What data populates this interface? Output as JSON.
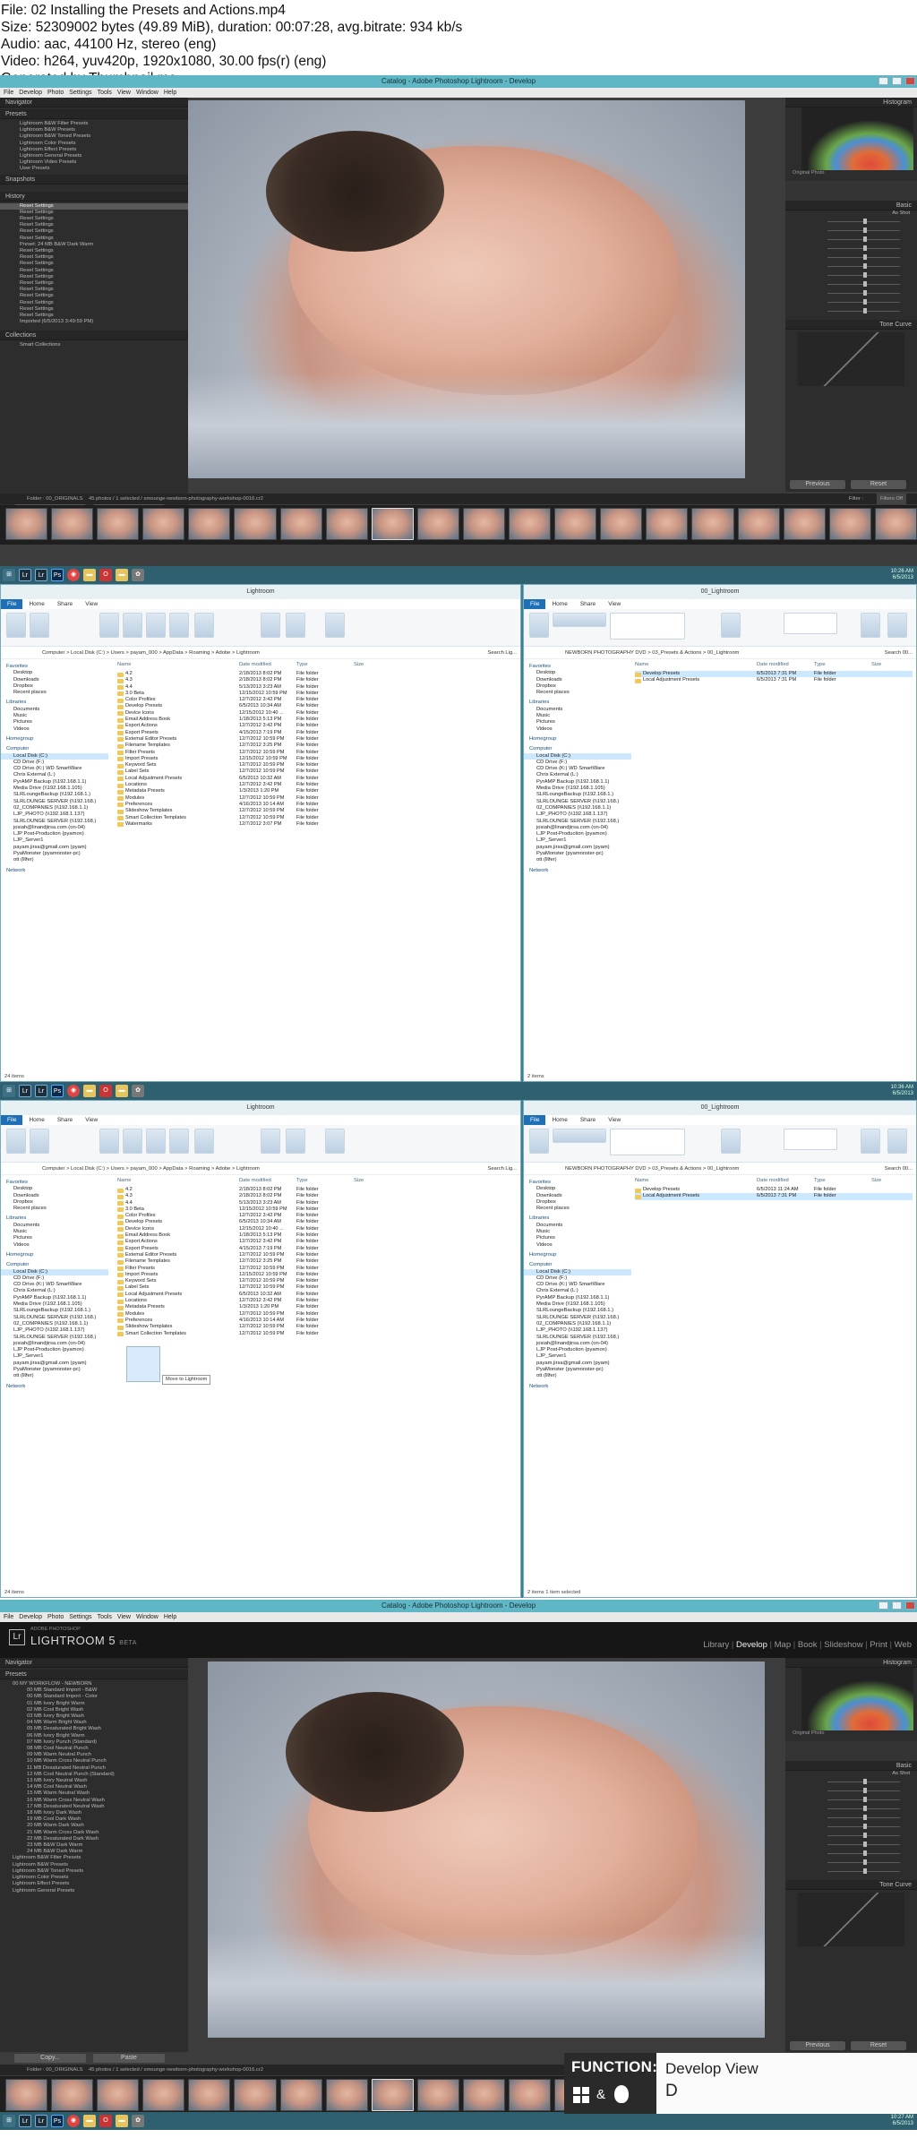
{
  "info": {
    "line1": "File: 02 Installing the Presets and Actions.mp4",
    "line2": "Size: 52309002 bytes (49.89 MiB), duration: 00:07:28, avg.bitrate: 934 kb/s",
    "line3": "Audio: aac, 44100 Hz, stereo (eng)",
    "line4": "Video: h264, yuv420p, 1920x1080, 30.00 fps(r) (eng)",
    "line5": "Generated by Thumbnail me"
  },
  "lr": {
    "title": "Catalog - Adobe Photoshop Lightroom - Develop",
    "menu": [
      "File",
      "Develop",
      "Photo",
      "Settings",
      "Tools",
      "View",
      "Window",
      "Help"
    ],
    "navigator": "Navigator",
    "presets": "Presets",
    "presets_items": [
      "Lightroom B&W Filter Presets",
      "Lightroom B&W Presets",
      "Lightroom B&W Toned Presets",
      "Lightroom Color Presets",
      "Lightroom Effect Presets",
      "Lightroom General Presets",
      "Lightroom Video Presets",
      "User Presets"
    ],
    "snapshots": "Snapshots",
    "history": "History",
    "history_items": [
      "Reset Settings",
      "Reset Settings",
      "Reset Settings",
      "Reset Settings",
      "Reset Settings",
      "Reset Settings",
      "Preset: 24 MB B&W Dark Warm",
      "Reset Settings",
      "Reset Settings",
      "Reset Settings",
      "Reset Settings",
      "Reset Settings",
      "Reset Settings",
      "Reset Settings",
      "Reset Settings",
      "Reset Settings",
      "Reset Settings",
      "Reset Settings",
      "Imported (6/5/2013 3:49:59 PM)"
    ],
    "collections": "Collections",
    "collections_item": "Smart Collections",
    "copy": "Copy...",
    "paste": "Paste",
    "histogram": "Histogram",
    "basic": "Basic",
    "tone_curve": "Tone Curve",
    "previous": "Previous",
    "reset": "Reset",
    "as_shot": "As Shot",
    "original_photo": "Original Photo",
    "folder": "Folder : 00_ORIGINALS",
    "photos": "45 photos / 1 selected /",
    "filename": "smounge-newborn-photography-workshop-0016.cr2",
    "filter": "Filter :",
    "filters_off": "Filters Off",
    "brand_small": "ADOBE PHOTOSHOP",
    "brand": "LIGHTROOM 5",
    "brand_beta": "BETA",
    "modules": [
      "Library",
      "Develop",
      "Map",
      "Book",
      "Slideshow",
      "Print",
      "Web"
    ],
    "presets2_group": "00 MY WORKFLOW - NEWBORN",
    "presets2_items": [
      "00 MB Standard Import - B&W",
      "00 MB Standard Import - Color",
      "01 MB Ivory Bright Warm",
      "02 MB Cool Bright Wash",
      "03 MB Ivory Bright Wash",
      "04 MB Warm Bright Wash",
      "05 MB Desaturated Bright Wash",
      "06 MB Ivory Bright Warm",
      "07 MB Ivory Punch (Standard)",
      "08 MB Cool Neutral Punch",
      "09 MB Warm Neutral Punch",
      "10 MB Warm Cross Neutral Punch",
      "11 MB Desaturated Neutral Punch",
      "12 MB Cool Neutral Punch (Standard)",
      "13 MB Ivory Neutral Wash",
      "14 MB Cool Neutral Wash",
      "15 MB Warm Neutral Wash",
      "16 MB Warm Cross Neutral Wash",
      "17 MB Desaturated Neutral Wash",
      "18 MB Ivory Dark Wash",
      "19 MB Cool Dark Wash",
      "20 MB Warm Dark Wash",
      "21 MB Warm Cross Dark Wash",
      "22 MB Desaturated Dark Wash",
      "23 MB B&W Dark Warm",
      "24 MB B&W Dark Warm"
    ],
    "presets2_more": [
      "Lightroom B&W Filter Presets",
      "Lightroom B&W Presets",
      "Lightroom B&W Toned Presets",
      "Lightroom Color Presets",
      "Lightroom Effect Presets",
      "Lightroom General Presets"
    ]
  },
  "explorer": {
    "left_title": "Lightroom",
    "right_title": "00_Lightroom",
    "tabs": [
      "File",
      "Home",
      "Share",
      "View"
    ],
    "path_left": "Computer > Local Disk (C:) > Users > payam_000 > AppData > Roaming > Adobe > Lightroom",
    "path_right": "NEWBORN PHOTOGRAPHY DVD > 03_Presets & Actions > 00_Lightroom",
    "search_left": "Search Lig...",
    "search_right": "Search 00...",
    "col_name": "Name",
    "col_date": "Date modified",
    "col_type": "Type",
    "col_size": "Size",
    "ribbon_left": [
      "Copy",
      "Paste",
      "Move to",
      "Copy to",
      "Delete",
      "Rename",
      "New folder",
      "Properties",
      "Open",
      "Select all"
    ],
    "ribbon_right": [
      "Navigation pane",
      "Preview pane",
      "Details pane",
      "Extra large icons",
      "Large icons",
      "Medium icons",
      "Small icons",
      "List",
      "Details",
      "Sort by",
      "Item check boxes",
      "File name extensions",
      "Hidden items",
      "Hide selected items",
      "Options"
    ],
    "nav": {
      "favorites": "Favorites",
      "fav_items": [
        "Desktop",
        "Downloads",
        "Dropbox",
        "Recent places"
      ],
      "libraries": "Libraries",
      "lib_items": [
        "Documents",
        "Music",
        "Pictures",
        "Videos"
      ],
      "homegroup": "Homegroup",
      "computer": "Computer",
      "comp_items": [
        "Local Disk (C:)",
        "CD Drive (F:)",
        "CD Drive (K:) WD SmartWare",
        "Chris External (L:)",
        "PyrAMP Backup (\\\\192.168.1.1)",
        "Media Drive (\\\\192.168.1.105)",
        "SLRLoungeBackup (\\\\192.168.1.)",
        "SLRLOUNGE SERVER (\\\\192.168.)",
        "02_COMPANIES (\\\\192.168.1.1)",
        "LJP_PHOTO (\\\\192.168.1.137)",
        "SLRLOUNGE SERVER (\\\\192.168.)",
        "josiah@linandjirsa.com (on-04)",
        "LJP Post-Production (pyamon)",
        "LJP_Server1",
        "payam.jirsa@gmail.com (pyam)",
        "PyaMonster (pyamonster-pc)",
        "ott (lllfer)"
      ],
      "network": "Network"
    },
    "left_rows": [
      [
        "4.2",
        "2/18/2013 8:02 PM",
        "File folder"
      ],
      [
        "4.3",
        "2/18/2013 8:02 PM",
        "File folder"
      ],
      [
        "4.4",
        "5/13/2013 3:23 AM",
        "File folder"
      ],
      [
        "3.0 Beta",
        "12/15/2012 10:59 PM",
        "File folder"
      ],
      [
        "Color Profiles",
        "12/7/2012 3:42 PM",
        "File folder"
      ],
      [
        "Develop Presets",
        "6/5/2013 10:34 AM",
        "File folder"
      ],
      [
        "Device Icons",
        "12/15/2012 10:40 ...",
        "File folder"
      ],
      [
        "Email Address Book",
        "1/18/2013 5:13 PM",
        "File folder"
      ],
      [
        "Export Actions",
        "12/7/2012 3:42 PM",
        "File folder"
      ],
      [
        "Export Presets",
        "4/15/2013 7:19 PM",
        "File folder"
      ],
      [
        "External Editor Presets",
        "12/7/2012 10:59 PM",
        "File folder"
      ],
      [
        "Filename Templates",
        "12/7/2012 3:25 PM",
        "File folder"
      ],
      [
        "Filter Presets",
        "12/7/2012 10:59 PM",
        "File folder"
      ],
      [
        "Import Presets",
        "12/15/2012 10:59 PM",
        "File folder"
      ],
      [
        "Keyword Sets",
        "12/7/2012 10:59 PM",
        "File folder"
      ],
      [
        "Label Sets",
        "12/7/2012 10:59 PM",
        "File folder"
      ],
      [
        "Local Adjustment Presets",
        "6/5/2013 10:32 AM",
        "File folder"
      ],
      [
        "Locations",
        "12/7/2012 3:42 PM",
        "File folder"
      ],
      [
        "Metadata Presets",
        "1/3/2013 1:20 PM",
        "File folder"
      ],
      [
        "Modules",
        "12/7/2012 10:59 PM",
        "File folder"
      ],
      [
        "Preferences",
        "4/16/2013 10:14 AM",
        "File folder"
      ],
      [
        "Slideshow Templates",
        "12/7/2012 10:59 PM",
        "File folder"
      ],
      [
        "Smart Collection Templates",
        "12/7/2012 10:59 PM",
        "File folder"
      ],
      [
        "Watermarks",
        "12/7/2012 3:07 PM",
        "File folder"
      ]
    ],
    "right_rows": [
      [
        "Develop Presets",
        "6/5/2013 7:31 PM",
        "File folder"
      ],
      [
        "Local Adjustment Presets",
        "6/5/2013 7:31 PM",
        "File folder"
      ]
    ],
    "right_rows_b": [
      [
        "Develop Presets",
        "6/5/2013 11:24 AM",
        "File folder"
      ],
      [
        "Local Adjustment Presets",
        "6/5/2013 7:31 PM",
        "File folder"
      ]
    ],
    "status_left": "24 items",
    "status_right": "2 items",
    "status_right_b": "2 items   1 item selected",
    "drag_tip": "Move to Lightroom"
  },
  "taskbar": {
    "clock1": "10:26 AM",
    "clock2": "10:36 AM",
    "clock3": "10:27 AM",
    "date": "6/5/2013"
  },
  "function": {
    "label": "FUNCTION:",
    "name": "Develop View",
    "key": "D",
    "and": "&"
  },
  "colors": {
    "taskbar": "#2f6070",
    "lr_title": "#5fb7c6",
    "accent": "#1e6fb5"
  }
}
